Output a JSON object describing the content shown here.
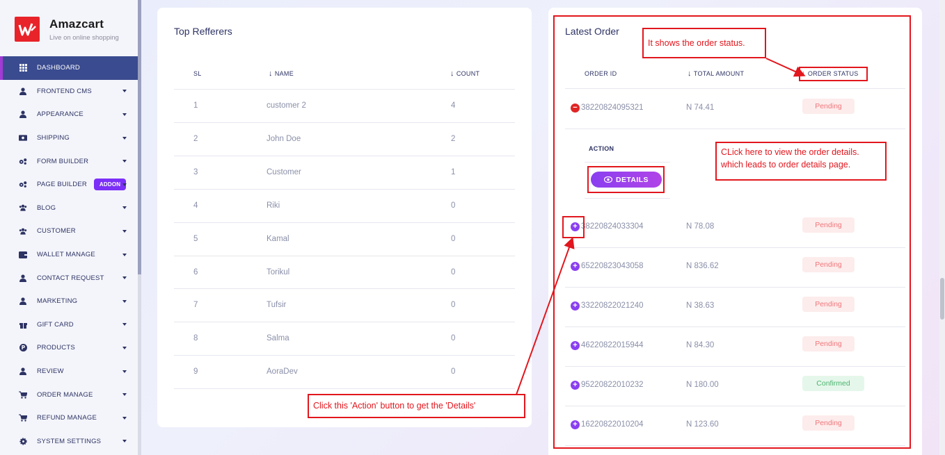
{
  "brand": {
    "name": "Amazcart",
    "tagline": "Live on online shopping"
  },
  "sidebar": {
    "items": [
      {
        "label": "DASHBOARD",
        "icon": "grid-icon",
        "active": true
      },
      {
        "label": "FRONTEND CMS",
        "icon": "user-icon"
      },
      {
        "label": "APPEARANCE",
        "icon": "user-icon"
      },
      {
        "label": "SHIPPING",
        "icon": "money-icon"
      },
      {
        "label": "FORM BUILDER",
        "icon": "gears-icon"
      },
      {
        "label": "PAGE BUILDER",
        "icon": "gears-icon",
        "badge": "ADDON"
      },
      {
        "label": "BLOG",
        "icon": "users-icon"
      },
      {
        "label": "CUSTOMER",
        "icon": "users-icon"
      },
      {
        "label": "WALLET MANAGE",
        "icon": "wallet-icon"
      },
      {
        "label": "CONTACT REQUEST",
        "icon": "user-icon"
      },
      {
        "label": "MARKETING",
        "icon": "user-icon"
      },
      {
        "label": "GIFT CARD",
        "icon": "gift-icon"
      },
      {
        "label": "PRODUCTS",
        "icon": "product-icon"
      },
      {
        "label": "REVIEW",
        "icon": "user-icon"
      },
      {
        "label": "ORDER MANAGE",
        "icon": "cart-icon"
      },
      {
        "label": "REFUND MANAGE",
        "icon": "cart-icon"
      },
      {
        "label": "SYSTEM SETTINGS",
        "icon": "gear-icon"
      }
    ]
  },
  "referrers": {
    "title": "Top Refferers",
    "headers": {
      "sl": "SL",
      "name": "NAME",
      "count": "COUNT"
    },
    "rows": [
      {
        "sl": "1",
        "name": "customer 2",
        "count": "4"
      },
      {
        "sl": "2",
        "name": "John Doe",
        "count": "2"
      },
      {
        "sl": "3",
        "name": "Customer",
        "count": "1"
      },
      {
        "sl": "4",
        "name": "Riki",
        "count": "0"
      },
      {
        "sl": "5",
        "name": "Kamal",
        "count": "0"
      },
      {
        "sl": "6",
        "name": "Torikul",
        "count": "0"
      },
      {
        "sl": "7",
        "name": "Tufsir",
        "count": "0"
      },
      {
        "sl": "8",
        "name": "Salma",
        "count": "0"
      },
      {
        "sl": "9",
        "name": "AoraDev",
        "count": "0"
      }
    ]
  },
  "orders": {
    "title": "Latest Order",
    "headers": {
      "id": "ORDER ID",
      "amount": "TOTAL AMOUNT",
      "status": "ORDER STATUS"
    },
    "expanded": {
      "action_label": "ACTION",
      "details_label": "DETAILS"
    },
    "rows": [
      {
        "id": "38220824095321",
        "amount": "N 74.41",
        "status": "Pending",
        "expanded": true
      },
      {
        "id": "38220824033304",
        "amount": "N 78.08",
        "status": "Pending"
      },
      {
        "id": "65220823043058",
        "amount": "N 836.62",
        "status": "Pending"
      },
      {
        "id": "33220822021240",
        "amount": "N 38.63",
        "status": "Pending"
      },
      {
        "id": "46220822015944",
        "amount": "N 84.30",
        "status": "Pending"
      },
      {
        "id": "95220822010232",
        "amount": "N 180.00",
        "status": "Confirmed"
      },
      {
        "id": "16220822010204",
        "amount": "N 123.60",
        "status": "Pending"
      }
    ]
  },
  "annotations": {
    "status_note": "It shows the order status.",
    "details_note_line1": "CLick here to view the order details.",
    "details_note_line2": "which leads to order details page.",
    "action_note": "Click this 'Action' button to get the 'Details'"
  },
  "colors": {
    "accent": "#8a3ff0",
    "nav_active": "#3a4b8f",
    "annotation": "#e2161d"
  }
}
